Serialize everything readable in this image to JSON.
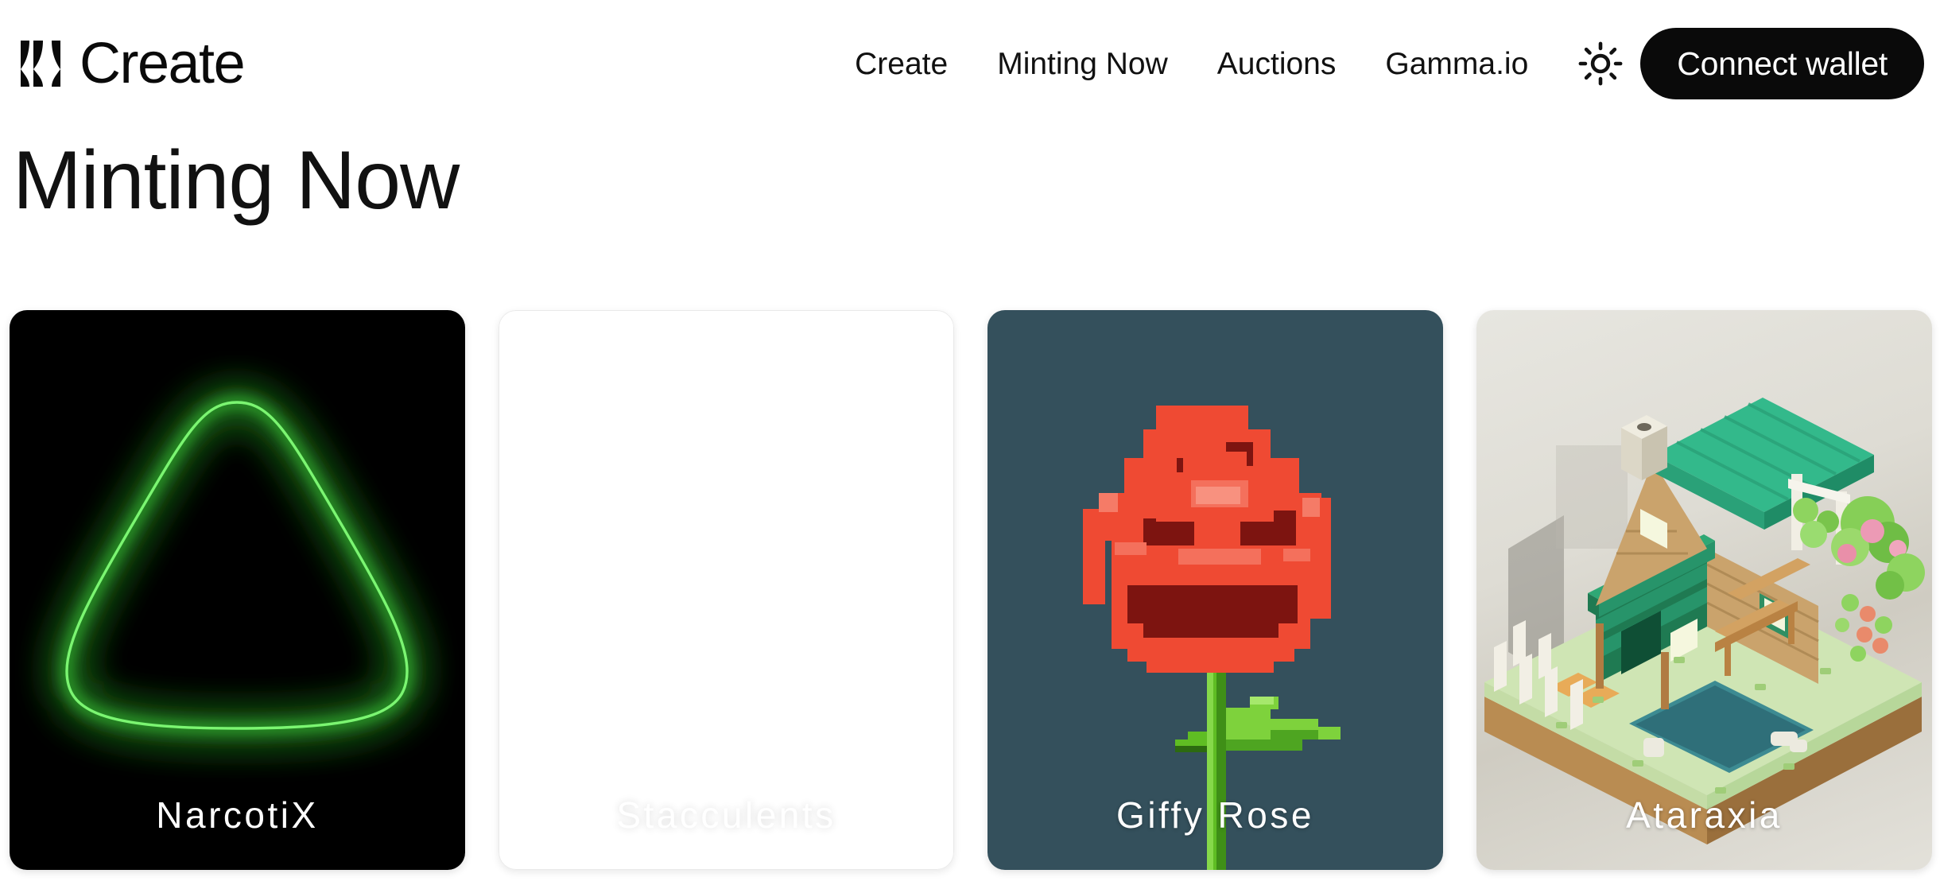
{
  "header": {
    "brand": {
      "name": "Create",
      "logo_icon": "hourglass-x-logo"
    },
    "nav": [
      {
        "label": "Create"
      },
      {
        "label": "Minting Now"
      },
      {
        "label": "Auctions"
      },
      {
        "label": "Gamma.io"
      }
    ],
    "theme_toggle": {
      "icon": "sun-icon"
    },
    "connect_wallet": {
      "label": "Connect wallet"
    }
  },
  "page": {
    "title": "Minting Now"
  },
  "cards": [
    {
      "label": "NarcotiX",
      "art": "neon-green-rounded-triangle-on-black",
      "background_color": "#000000",
      "accent_color": "#3ddb39"
    },
    {
      "label": "Stacculents",
      "art": "blank-white-placeholder",
      "background_color": "#ffffff",
      "accent_color": "#ffffff"
    },
    {
      "label": "Giffy Rose",
      "art": "pixel-art-red-rose-with-green-stem",
      "background_color": "#34505c",
      "accent_color": "#ef4a33"
    },
    {
      "label": "Ataraxia",
      "art": "voxel-isometric-cabin-with-pond-and-garden",
      "background_color": "#ddd9d0",
      "accent_color": "#3dbf8e"
    }
  ],
  "colors": {
    "page_background": "#ffffff",
    "text_primary": "#111111",
    "button_background": "#0a0a0a",
    "button_text": "#ffffff"
  }
}
